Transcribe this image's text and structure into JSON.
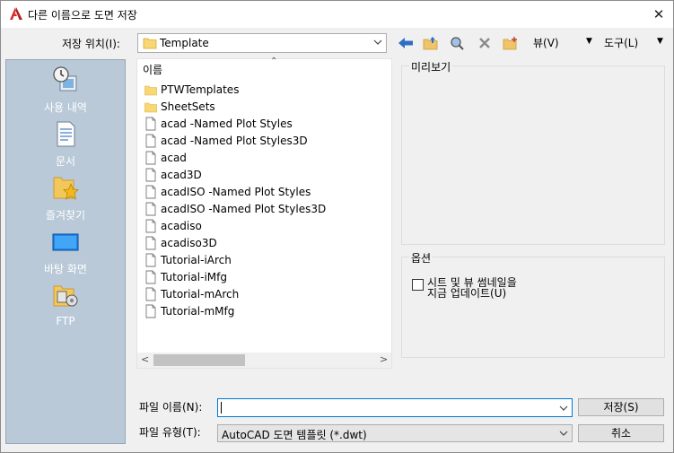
{
  "window": {
    "title": "다른 이름으로 도면 저장",
    "close_glyph": "✕"
  },
  "lookin": {
    "label": "저장 위치(I):",
    "value": "Template"
  },
  "toolbar": {
    "views_label": "뷰(V)",
    "tools_label": "도구(L)",
    "dropdown_glyph": "▼"
  },
  "places": [
    {
      "label": "사용 내역",
      "icon": "history-icon"
    },
    {
      "label": "문서",
      "icon": "documents-icon"
    },
    {
      "label": "즐겨찾기",
      "icon": "favorites-icon"
    },
    {
      "label": "바탕 화면",
      "icon": "desktop-icon"
    },
    {
      "label": "FTP",
      "icon": "ftp-icon"
    }
  ],
  "filelist": {
    "column_name": "이름",
    "items": [
      {
        "name": "PTWTemplates",
        "type": "folder"
      },
      {
        "name": "SheetSets",
        "type": "folder"
      },
      {
        "name": "acad -Named Plot Styles",
        "type": "file"
      },
      {
        "name": "acad -Named Plot Styles3D",
        "type": "file"
      },
      {
        "name": "acad",
        "type": "file"
      },
      {
        "name": "acad3D",
        "type": "file"
      },
      {
        "name": "acadISO -Named Plot Styles",
        "type": "file"
      },
      {
        "name": "acadISO -Named Plot Styles3D",
        "type": "file"
      },
      {
        "name": "acadiso",
        "type": "file"
      },
      {
        "name": "acadiso3D",
        "type": "file"
      },
      {
        "name": "Tutorial-iArch",
        "type": "file"
      },
      {
        "name": "Tutorial-iMfg",
        "type": "file"
      },
      {
        "name": "Tutorial-mArch",
        "type": "file"
      },
      {
        "name": "Tutorial-mMfg",
        "type": "file"
      }
    ]
  },
  "preview": {
    "label": "미리보기"
  },
  "options": {
    "label": "옵션",
    "checkbox_line1": "시트 및 뷰 썸네일을",
    "checkbox_line2": "지금 업데이트(U)",
    "checked": false
  },
  "filename": {
    "label": "파일 이름(N):",
    "value": ""
  },
  "filetype": {
    "label": "파일 유형(T):",
    "value": "AutoCAD 도면 템플릿 (*.dwt)"
  },
  "buttons": {
    "save": "저장(S)",
    "cancel": "취소"
  },
  "colors": {
    "places_bg": "#b9c9d8",
    "folder": "#f8d775",
    "accent": "#0078d7"
  }
}
